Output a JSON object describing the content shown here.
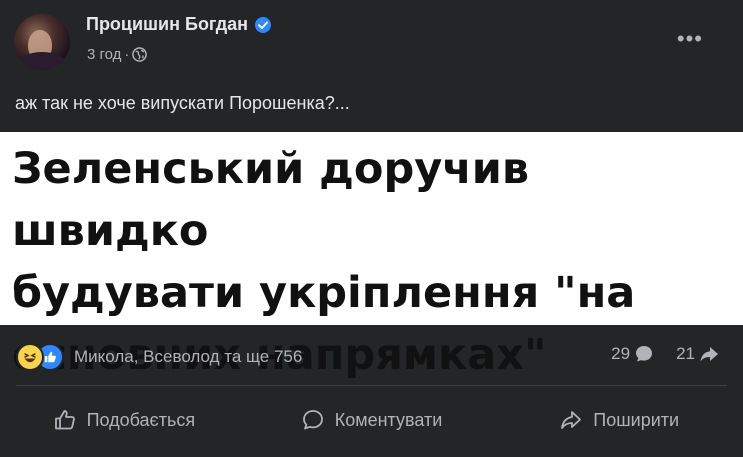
{
  "post": {
    "author": "Процишин Богдан",
    "time": "3 год",
    "separator": "·",
    "more_label": "•••",
    "caption": "аж так не хоче випускати Порошенка?...",
    "headline_lines": [
      "Зеленський доручив швидко",
      "будувати укріплення \"на",
      "основних напрямках\""
    ],
    "reactions_text": "Микола, Всеволод та ще 756",
    "comments_count": "29",
    "shares_count": "21",
    "actions": {
      "like": "Подобається",
      "comment": "Коментувати",
      "share": "Поширити"
    }
  },
  "colors": {
    "background": "#242526",
    "primary_text": "#e4e6eb",
    "secondary_text": "#b0b3b8",
    "verified_blue": "#2d88ff",
    "headline_bg": "#ffffff"
  },
  "icons": [
    "verified-badge-icon",
    "globe-icon",
    "more-options-icon",
    "haha-reaction-icon",
    "like-reaction-icon",
    "comment-icon",
    "share-icon",
    "thumbs-up-icon"
  ]
}
